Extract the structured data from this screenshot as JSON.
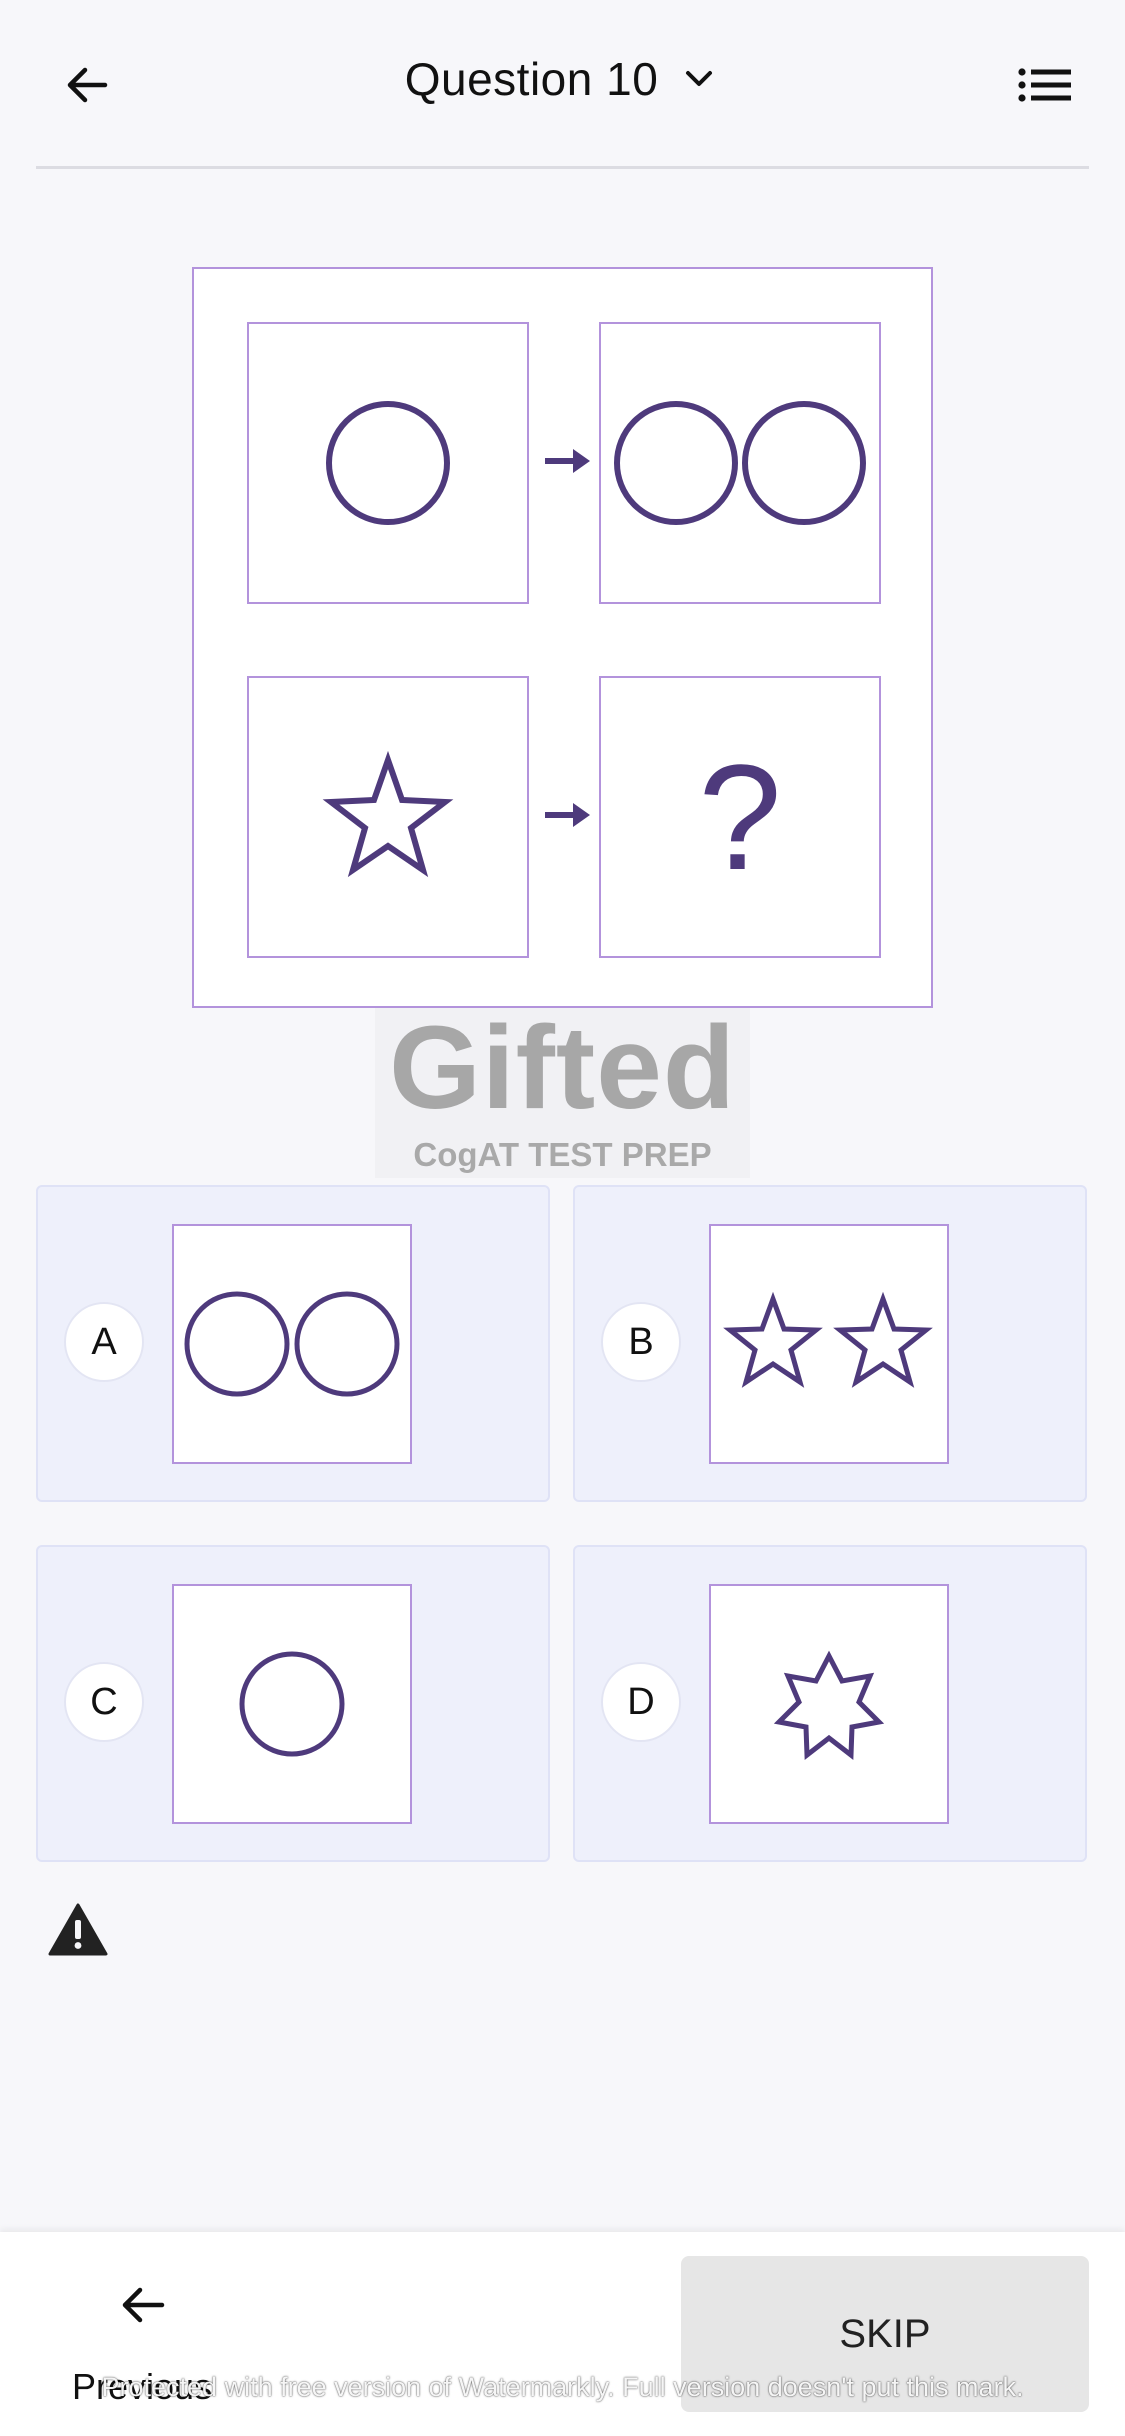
{
  "header": {
    "title": "Question 10",
    "back_icon": "arrow-left-icon",
    "dropdown_icon": "chevron-down-icon",
    "menu_icon": "list-icon"
  },
  "puzzle": {
    "cells": [
      {
        "content": "one circle"
      },
      {
        "content": "two circles"
      },
      {
        "content": "one star"
      },
      {
        "content": "?"
      }
    ],
    "question_mark": "?",
    "shape_color": "#4e3a7c",
    "border_color": "#b393dc"
  },
  "logo": {
    "word": "Gifted",
    "subtitle": "CogAT TEST PREP"
  },
  "options": [
    {
      "letter": "A",
      "shape": "two circles"
    },
    {
      "letter": "B",
      "shape": "two stars"
    },
    {
      "letter": "C",
      "shape": "one circle"
    },
    {
      "letter": "D",
      "shape": "seven-point star"
    }
  ],
  "report_icon": "warning-icon",
  "footer": {
    "previous_label": "Previous",
    "previous_icon": "arrow-left-icon",
    "skip_label": "SKIP",
    "watermark": "Protected with free version of Watermarkly. Full version doesn't put this mark."
  }
}
